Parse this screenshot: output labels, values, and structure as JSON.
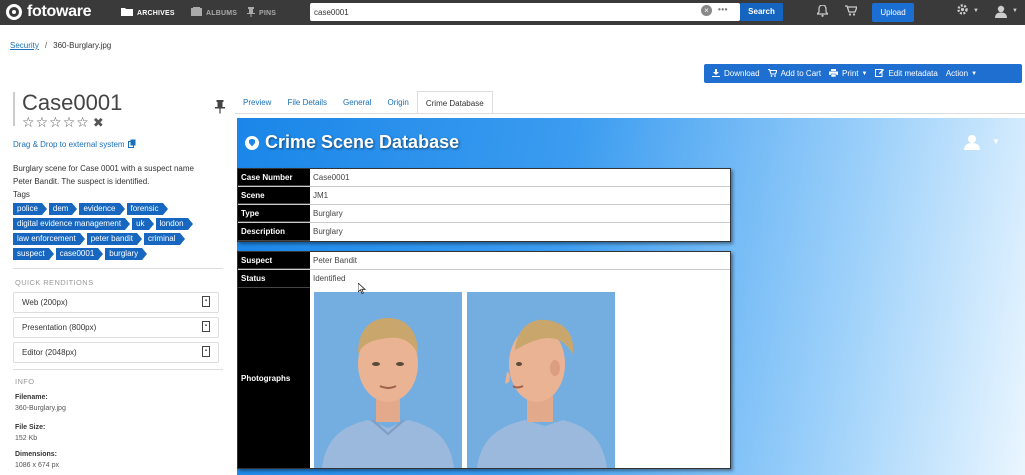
{
  "app": {
    "logo_text": "fotoware"
  },
  "nav": {
    "archives": "ARCHIVES",
    "albums": "ALBUMS",
    "pins": "PINS"
  },
  "search": {
    "value": "case0001",
    "clear": "×",
    "more": "•••",
    "button": "Search"
  },
  "header": {
    "upload": "Upload"
  },
  "breadcrumb": {
    "root": "Security",
    "separator": "/",
    "current": "360-Burglary.jpg"
  },
  "actions": {
    "download": "Download",
    "add_to_cart": "Add to Cart",
    "print": "Print",
    "edit_metadata": "Edit metadata",
    "action": "Action"
  },
  "asset": {
    "title": "Case0001",
    "rating_stars": 5,
    "drag_drop": "Drag & Drop to external system",
    "description": "Burglary scene for Case 0001 with a suspect name Peter Bandit. The suspect is identified.",
    "tags_label": "Tags",
    "tags": [
      "police",
      "dem",
      "evidence",
      "forensic",
      "digital evidence management",
      "uk",
      "london",
      "law enforcement",
      "peter bandit",
      "criminal",
      "suspect",
      "case0001",
      "burglary"
    ]
  },
  "quick_renditions": {
    "heading": "QUICK RENDITIONS",
    "items": [
      "Web (200px)",
      "Presentation (800px)",
      "Editor (2048px)"
    ]
  },
  "info": {
    "heading": "INFO",
    "filename_label": "Filename:",
    "filename": "360-Burglary.jpg",
    "filesize_label": "File Size:",
    "filesize": "152 Kb",
    "dimensions_label": "Dimensions:",
    "dimensions": "1086 x 674 px"
  },
  "tabs": [
    "Preview",
    "File Details",
    "General",
    "Origin",
    "Crime Database"
  ],
  "active_tab": "Crime Database",
  "crime_db": {
    "title": "Crime Scene Database",
    "case_rows": [
      {
        "key": "Case Number",
        "value": "Case0001"
      },
      {
        "key": "Scene",
        "value": "JM1"
      },
      {
        "key": "Type",
        "value": "Burglary"
      },
      {
        "key": "Description",
        "value": "Burglary"
      }
    ],
    "suspect_rows": [
      {
        "key": "Suspect",
        "value": "Peter Bandit"
      },
      {
        "key": "Status",
        "value": "Identified"
      }
    ],
    "photos_label": "Photographs"
  },
  "colors": {
    "topbar": "#3a3a3a",
    "accent": "#1e6fd0",
    "tag": "#1767c0",
    "link": "#1a6fb8"
  }
}
